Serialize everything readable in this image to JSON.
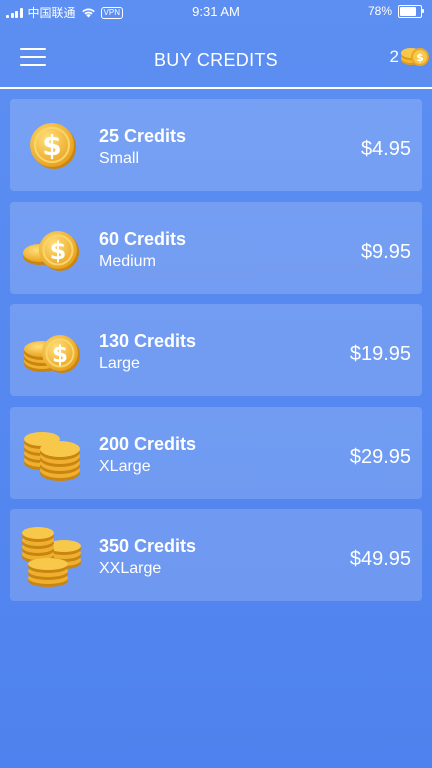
{
  "status_bar": {
    "carrier": "中国联通",
    "vpn": "VPN",
    "time": "9:31 AM",
    "battery_text": "78%",
    "battery_level": 0.78
  },
  "nav": {
    "title": "BUY CREDITS",
    "credit_count": "2",
    "menu_icon": "hamburger-menu-icon",
    "coin_icon": "coin-stack-icon"
  },
  "products": [
    {
      "credits": "25 Credits",
      "size": "Small",
      "price": "$4.95",
      "icon": "single-coin-icon"
    },
    {
      "credits": "60 Credits",
      "size": "Medium",
      "price": "$9.95",
      "icon": "two-coins-icon"
    },
    {
      "credits": "130 Credits",
      "size": "Large",
      "price": "$19.95",
      "icon": "coin-stack-small-icon"
    },
    {
      "credits": "200 Credits",
      "size": "XLarge",
      "price": "$29.95",
      "icon": "coin-stacks-icon"
    },
    {
      "credits": "350 Credits",
      "size": "XXLarge",
      "price": "$49.95",
      "icon": "coin-pile-icon"
    }
  ],
  "colors": {
    "background": "#5689f0",
    "card": "rgba(255,255,255,0.17)",
    "coin_gold": "#f2b72e",
    "text": "#ffffff"
  }
}
